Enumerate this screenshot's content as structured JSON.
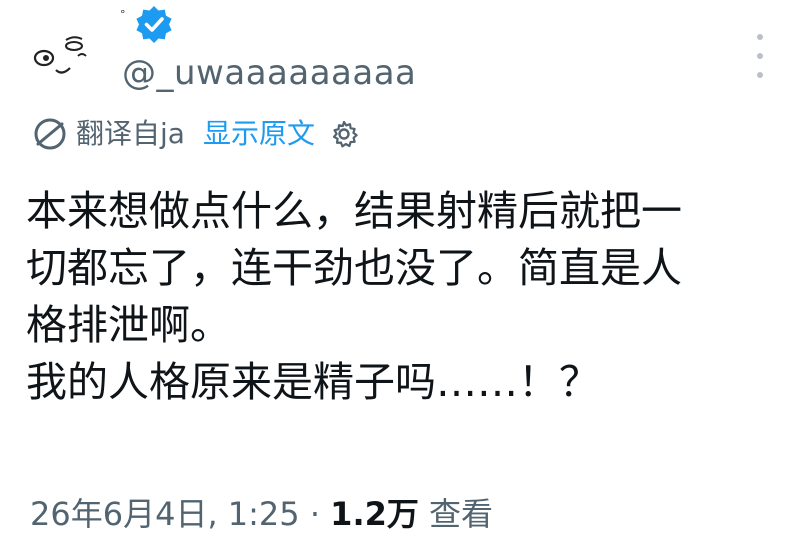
{
  "author": {
    "display_name": "°",
    "handle": "@_uwaaaaaaaaa"
  },
  "translation": {
    "from_label": "翻译自ja",
    "show_original": "显示原文"
  },
  "tweet": {
    "lines": [
      "本来想做点什么，结果射精后就把一",
      "切都忘了，连干劲也没了。简直是人",
      "格排泄啊。",
      "我的人格原来是精子吗……！？"
    ]
  },
  "meta": {
    "timestamp": "26年6月4日, 1:25",
    "separator": "·",
    "views_count": "1.2万",
    "views_label": "查看"
  },
  "colors": {
    "accent": "#1d9bf0",
    "secondary_text": "#536471",
    "primary_text": "#0f1419"
  },
  "icons": {
    "verified": "verified-badge-icon",
    "translate": "translate-globe-icon",
    "settings": "gear-icon",
    "more": "more-vertical-icon"
  }
}
